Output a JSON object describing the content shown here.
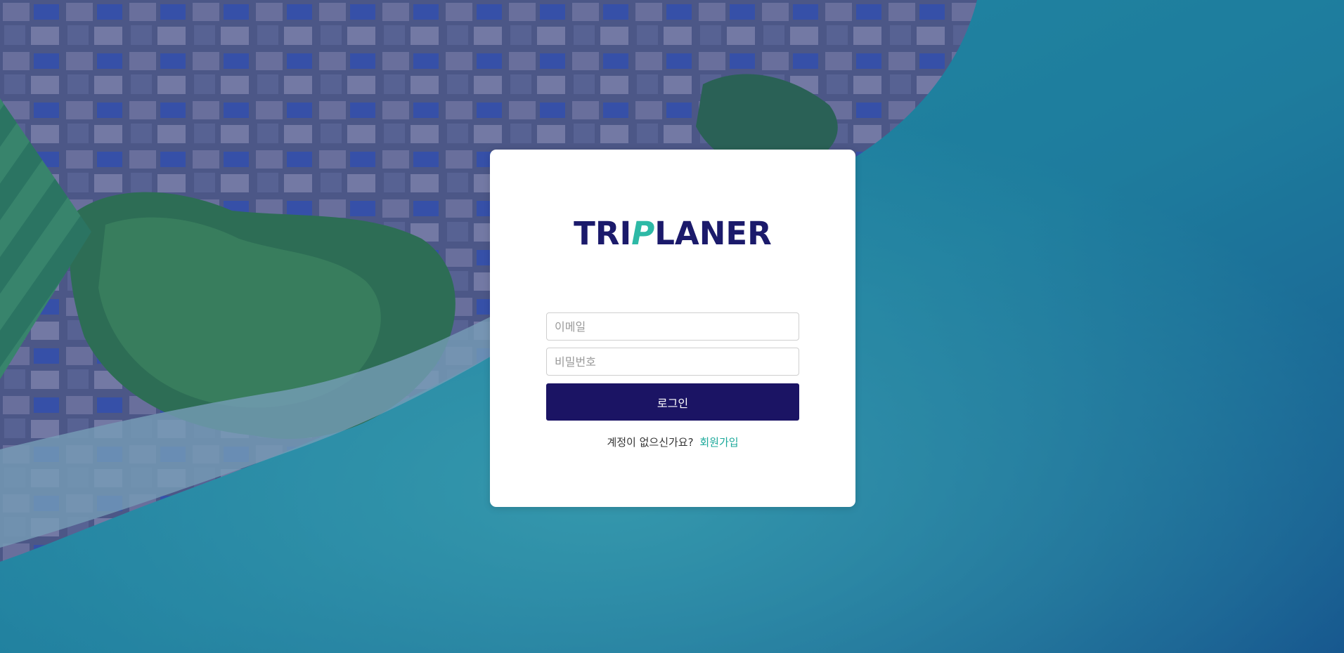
{
  "brand": {
    "logo_prefix": "TRI",
    "logo_accent": "P",
    "logo_suffix": "LANER",
    "primary_color": "#1b1464",
    "accent_color": "#2db9a6"
  },
  "login_form": {
    "email_placeholder": "이메일",
    "password_placeholder": "비밀번호",
    "submit_label": "로그인",
    "signup_prompt": "계정이 없으신가요?",
    "signup_link": "회원가입"
  }
}
